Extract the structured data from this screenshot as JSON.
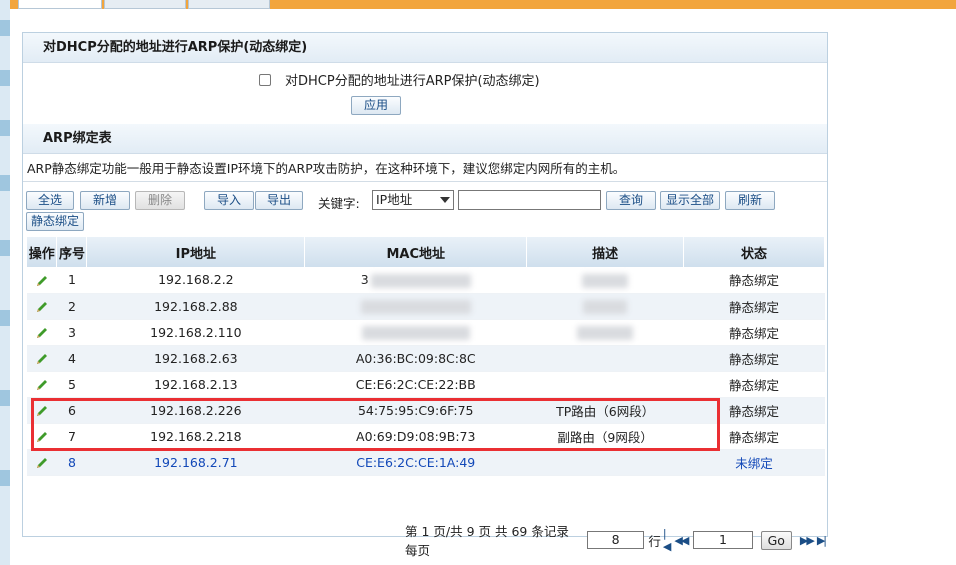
{
  "dhcp_section": {
    "title": "对DHCP分配的地址进行ARP保护(动态绑定)",
    "checkbox_label": "对DHCP分配的地址进行ARP保护(动态绑定)",
    "apply_label": "应用"
  },
  "arp_section": {
    "title": "ARP绑定表",
    "description": "ARP静态绑定功能一般用于静态设置IP环境下的ARP攻击防护，在这种环境下，建议您绑定内网所有的主机。"
  },
  "toolbar": {
    "select_all": "全选",
    "add": "新增",
    "delete": "删除",
    "import": "导入",
    "export": "导出",
    "keyword_label": "关键字:",
    "keyword_select": "IP地址",
    "search": "查询",
    "show_all": "显示全部",
    "refresh": "刷新",
    "static_bind": "静态绑定"
  },
  "table": {
    "headers": [
      "操作",
      "序号",
      "IP地址",
      "MAC地址",
      "描述",
      "状态"
    ],
    "rows": [
      {
        "no": "1",
        "ip": "192.168.2.2",
        "mac": "3",
        "desc": "",
        "status": "静态绑定"
      },
      {
        "no": "2",
        "ip": "192.168.2.88",
        "mac": "",
        "desc": "",
        "status": "静态绑定"
      },
      {
        "no": "3",
        "ip": "192.168.2.110",
        "mac": "",
        "desc": "",
        "status": "静态绑定"
      },
      {
        "no": "4",
        "ip": "192.168.2.63",
        "mac": "A0:36:BC:09:8C:8C",
        "desc": "",
        "status": "静态绑定"
      },
      {
        "no": "5",
        "ip": "192.168.2.13",
        "mac": "CE:E6:2C:CE:22:BB",
        "desc": "",
        "status": "静态绑定"
      },
      {
        "no": "6",
        "ip": "192.168.2.226",
        "mac": "54:75:95:C9:6F:75",
        "desc": "TP路由（6网段）",
        "status": "静态绑定"
      },
      {
        "no": "7",
        "ip": "192.168.2.218",
        "mac": "A0:69:D9:08:9B:73",
        "desc": "副路由（9网段）",
        "status": "静态绑定"
      },
      {
        "no": "8",
        "ip": "192.168.2.71",
        "mac": "CE:E6:2C:CE:1A:49",
        "desc": "",
        "status": "未绑定"
      }
    ]
  },
  "pager": {
    "text": "第 1 页/共 9 页 共 69 条记录 每页",
    "per_page": "8",
    "row_unit": "行",
    "page_value": "1",
    "go": "Go"
  },
  "colors": {
    "accent": "#f2a53d",
    "highlight": "#ea2f33",
    "link": "#1248b8"
  }
}
